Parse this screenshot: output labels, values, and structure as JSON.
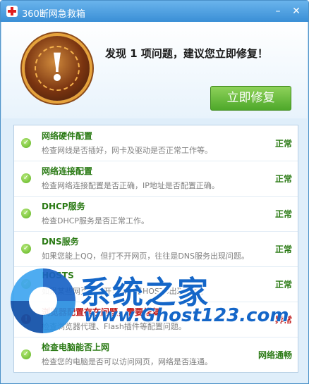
{
  "window": {
    "title": "360断网急救箱",
    "minimize_icon": "minimize-icon",
    "close_icon": "close-icon"
  },
  "header": {
    "headline": "发现 1 项问题，建议您立即修复！",
    "fix_button": "立即修复",
    "alert_icon": "exclamation-icon"
  },
  "checks": [
    {
      "title": "网络硬件配置",
      "desc": "检查网线是否插好，网卡及驱动是否正常工作等。",
      "status": "正常",
      "state": "ok"
    },
    {
      "title": "网络连接配置",
      "desc": "检查网络连接配置是否正确，IP地址是否配置正确。",
      "status": "正常",
      "state": "ok"
    },
    {
      "title": "DHCP服务",
      "desc": "检查DHCP服务是否正常工作。",
      "status": "正常",
      "state": "ok"
    },
    {
      "title": "DNS服务",
      "desc": "如果您能上QQ，但打不开网页，往往是DNS服务出现问题。",
      "status": "正常",
      "state": "ok"
    },
    {
      "title": "HOSTS",
      "desc": "如果某些网页打不开，可能是HOSTS出现问题。",
      "status": "正常",
      "state": "ok"
    },
    {
      "title": "浏览器配置存在问题，需要修复",
      "desc": "检查浏览器代理、Flash插件等配置问题。",
      "status": "异常",
      "state": "error"
    },
    {
      "title": "检查电脑能否上网",
      "desc": "检查您的电脑是否可以访问网页，网络是否连通。",
      "status": "网络通畅",
      "state": "ok"
    }
  ],
  "watermark": {
    "text": "系统之家",
    "url": "www.Ghost123.com"
  },
  "colors": {
    "ok": "#2a7a14",
    "error": "#c01818",
    "accent": "#3a8fd6",
    "button": "#4ea82a"
  }
}
